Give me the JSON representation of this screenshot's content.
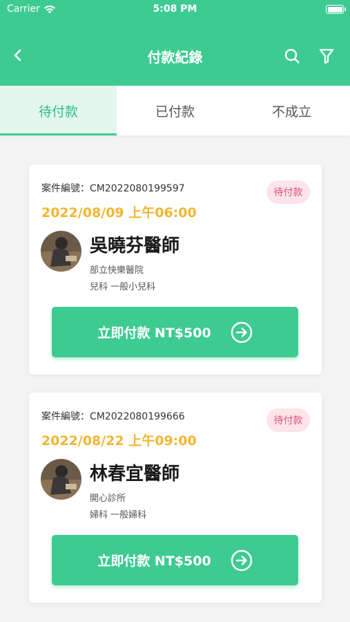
{
  "status_bar": {
    "carrier": "Carrier",
    "time": "5:08 PM"
  },
  "nav": {
    "title": "付款紀錄"
  },
  "tabs": [
    {
      "label": "待付款",
      "active": true
    },
    {
      "label": "已付款",
      "active": false
    },
    {
      "label": "不成立",
      "active": false
    }
  ],
  "cards": [
    {
      "case_no": "案件編號：CM2022080199597",
      "status": "待付款",
      "datetime": "2022/08/09 上午06:00",
      "doctor": "吳曉芬醫師",
      "clinic": "部立快樂醫院",
      "department": "兒科 一般小兒科",
      "pay_label": "立即付款 NT$500"
    },
    {
      "case_no": "案件編號：CM2022080199666",
      "status": "待付款",
      "datetime": "2022/08/22 上午09:00",
      "doctor": "林春宜醫師",
      "clinic": "開心診所",
      "department": "婦科 一般婦科",
      "pay_label": "立即付款 NT$500"
    }
  ],
  "colors": {
    "brand": "#3ecb92",
    "date": "#f2b632",
    "badge_bg": "#fce4ea",
    "badge_text": "#e0517a"
  },
  "icons": [
    "wifi-icon",
    "battery-icon",
    "back-arrow-icon",
    "search-icon",
    "filter-icon",
    "arrow-right-circle-icon"
  ]
}
